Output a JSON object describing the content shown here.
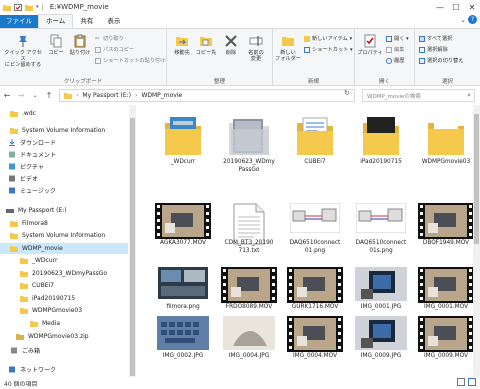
{
  "window": {
    "title": "E:¥WDMP_movie"
  },
  "tabs": [
    "ファイル",
    "ホーム",
    "共有",
    "表示"
  ],
  "ribbon": {
    "clipboard": {
      "pin": "クイック アクセス\nにピン留めする",
      "copy": "コピー",
      "paste": "貼り付け",
      "cut": "切り取り",
      "copy_path": "パスのコピー",
      "paste_shortcut": "ショートカットの貼り付け",
      "label": "クリップボード"
    },
    "organize": {
      "move_to": "移動先",
      "copy_to": "コピー先",
      "delete": "削除",
      "rename": "名前の\n変更",
      "label": "整理"
    },
    "new": {
      "new_folder": "新しい\nフォルダー",
      "new_item": "新しいアイテム ▾",
      "shortcut": "ショートカット ▾",
      "label": "新規"
    },
    "open": {
      "properties": "プロパティ",
      "open": "開く ▾",
      "edit": "編集",
      "history": "履歴",
      "label": "開く"
    },
    "select": {
      "select_all": "すべて選択",
      "select_none": "選択解除",
      "invert": "選択の切り替え",
      "label": "選択"
    }
  },
  "address": {
    "crumbs": [
      "My Passport (E:)",
      "WDMP_movie"
    ],
    "search_placeholder": "WDMP_movieの検索"
  },
  "sidebar": [
    {
      "label": ".wdc",
      "icon": "folder-icon",
      "selected": false
    },
    {
      "label": "System Volume Information",
      "icon": "folder-icon",
      "selected": false
    },
    {
      "label": "ダウンロード",
      "icon": "download-icon",
      "selected": false
    },
    {
      "label": "ドキュメント",
      "icon": "document-icon",
      "selected": false
    },
    {
      "label": "ピクチャ",
      "icon": "pictures-icon",
      "selected": false
    },
    {
      "label": "ビデオ",
      "icon": "video-icon",
      "selected": false
    },
    {
      "label": "ミュージック",
      "icon": "music-icon",
      "selected": false
    },
    {
      "label": "My Passport (E:)",
      "icon": "drive-icon",
      "selected": false
    },
    {
      "label": "Filmora8",
      "icon": "folder-icon",
      "selected": false
    },
    {
      "label": "System Volume Information",
      "icon": "folder-icon",
      "selected": false
    },
    {
      "label": "WDMP_movie",
      "icon": "folder-icon",
      "selected": true
    },
    {
      "label": "_WDcurr",
      "icon": "folder-icon",
      "selected": false
    },
    {
      "label": "20190623_WDmyPassGo",
      "icon": "folder-icon",
      "selected": false
    },
    {
      "label": "CUBEi7",
      "icon": "folder-icon",
      "selected": false
    },
    {
      "label": "iPad20190715",
      "icon": "folder-icon",
      "selected": false
    },
    {
      "label": "WDMPGmovie03",
      "icon": "folder-icon",
      "selected": false
    },
    {
      "label": "Media",
      "icon": "folder-icon",
      "selected": false
    },
    {
      "label": "WDMPGmovie03.zip",
      "icon": "zip-icon",
      "selected": false
    },
    {
      "label": "ごみ箱",
      "icon": "recycle-bin-icon",
      "selected": false
    },
    {
      "label": "ネットワーク",
      "icon": "network-icon",
      "selected": false
    }
  ],
  "files": [
    {
      "name": "_WDcurr",
      "kind": "folder-docs"
    },
    {
      "name": "20190623_WDmy\nPassGo",
      "kind": "folder-photo"
    },
    {
      "name": "CUBEi7",
      "kind": "folder-doc"
    },
    {
      "name": "iPad20190715",
      "kind": "folder-dark"
    },
    {
      "name": "WDMPGmovie03",
      "kind": "folder-plain"
    },
    {
      "name": "AGKA3077.MOV",
      "kind": "video-film"
    },
    {
      "name": "CDM_BT3_20190\n713.txt",
      "kind": "text"
    },
    {
      "name": "DAQ6510connect\n01.png",
      "kind": "image-diagram"
    },
    {
      "name": "DAQ6510connect\n01s.png",
      "kind": "image-diagram"
    },
    {
      "name": "DBOF1949.MOV",
      "kind": "video-film"
    },
    {
      "name": "filmora.png",
      "kind": "image-screen"
    },
    {
      "name": "FRDO8089.MOV",
      "kind": "video-film"
    },
    {
      "name": "GURK1716.MOV",
      "kind": "video-film"
    },
    {
      "name": "IMG_0001.JPG",
      "kind": "image-device"
    },
    {
      "name": "IMG_0001.MOV",
      "kind": "video-film"
    },
    {
      "name": "IMG_0002.JPG",
      "kind": "image-keyboard"
    },
    {
      "name": "IMG_0004.JPG",
      "kind": "image-shadow"
    },
    {
      "name": "IMG_0004.MOV",
      "kind": "video-film"
    },
    {
      "name": "IMG_0009.JPG",
      "kind": "image-device"
    },
    {
      "name": "IMG_0009.MOV",
      "kind": "video-film"
    }
  ],
  "status": {
    "count": "40 個の項目"
  },
  "colors": {
    "accent": "#1979ca",
    "selection": "#cce8ff",
    "folder": "#f5c94b"
  }
}
